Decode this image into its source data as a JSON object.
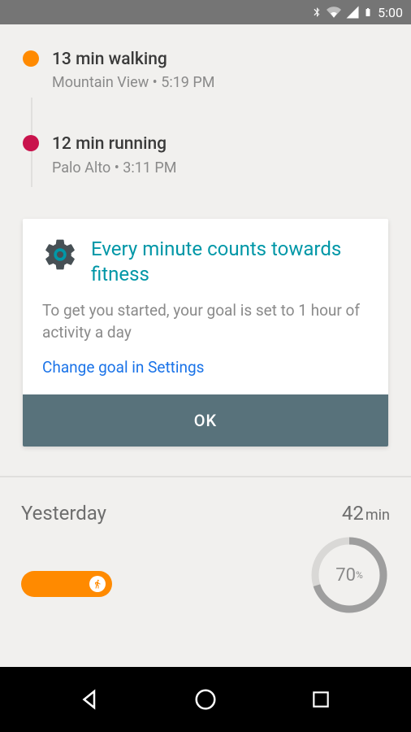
{
  "status": {
    "time": "5:00"
  },
  "activities": [
    {
      "title": "13 min walking",
      "subtitle": "Mountain View • 5:19 PM",
      "color": "orange"
    },
    {
      "title": "12 min running",
      "subtitle": "Palo Alto • 3:11 PM",
      "color": "pink"
    }
  ],
  "card": {
    "title": "Every minute counts towards fitness",
    "body": "To get you started, your goal is set to 1 hour of activity a day",
    "link": "Change goal in Settings",
    "ok": "OK"
  },
  "yesterday": {
    "label": "Yesterday",
    "value": "42",
    "unit": "min",
    "progress_percent": "70",
    "progress_suffix": "%"
  }
}
